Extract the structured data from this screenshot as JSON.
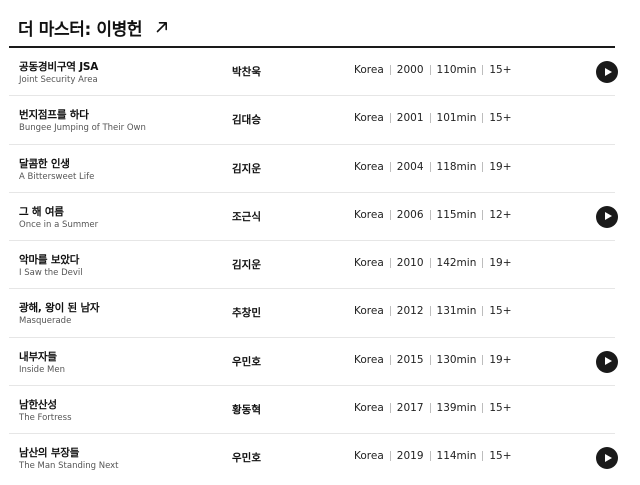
{
  "header": {
    "title": "더 마스터: 이병헌",
    "link_icon": "arrow-up-right-icon"
  },
  "movies": [
    {
      "ko": "공동경비구역 JSA",
      "en": "Joint Security Area",
      "director": "박찬욱",
      "country": "Korea",
      "year": "2000",
      "runtime": "110min",
      "rating": "15+",
      "has_play": true
    },
    {
      "ko": "번지점프를 하다",
      "en": "Bungee Jumping of Their Own",
      "director": "김대승",
      "country": "Korea",
      "year": "2001",
      "runtime": "101min",
      "rating": "15+",
      "has_play": false
    },
    {
      "ko": "달콤한 인생",
      "en": "A Bittersweet Life",
      "director": "김지운",
      "country": "Korea",
      "year": "2004",
      "runtime": "118min",
      "rating": "19+",
      "has_play": false
    },
    {
      "ko": "그 해 여름",
      "en": "Once in a Summer",
      "director": "조근식",
      "country": "Korea",
      "year": "2006",
      "runtime": "115min",
      "rating": "12+",
      "has_play": true
    },
    {
      "ko": "악마를 보았다",
      "en": "I Saw the Devil",
      "director": "김지운",
      "country": "Korea",
      "year": "2010",
      "runtime": "142min",
      "rating": "19+",
      "has_play": false
    },
    {
      "ko": "광해, 왕이 된 남자",
      "en": "Masquerade",
      "director": "추창민",
      "country": "Korea",
      "year": "2012",
      "runtime": "131min",
      "rating": "15+",
      "has_play": false
    },
    {
      "ko": "내부자들",
      "en": "Inside Men",
      "director": "우민호",
      "country": "Korea",
      "year": "2015",
      "runtime": "130min",
      "rating": "19+",
      "has_play": true
    },
    {
      "ko": "남한산성",
      "en": "The Fortress",
      "director": "황동혁",
      "country": "Korea",
      "year": "2017",
      "runtime": "139min",
      "rating": "15+",
      "has_play": false
    },
    {
      "ko": "남산의 부장들",
      "en": "The Man Standing Next",
      "director": "우민호",
      "country": "Korea",
      "year": "2019",
      "runtime": "114min",
      "rating": "15+",
      "has_play": true
    }
  ],
  "colors": {
    "text": "#111111",
    "subtext": "#555555",
    "divider": "#e6e6e6",
    "play_button": "#1a1a1a"
  },
  "icons": {
    "play": "play-icon"
  }
}
